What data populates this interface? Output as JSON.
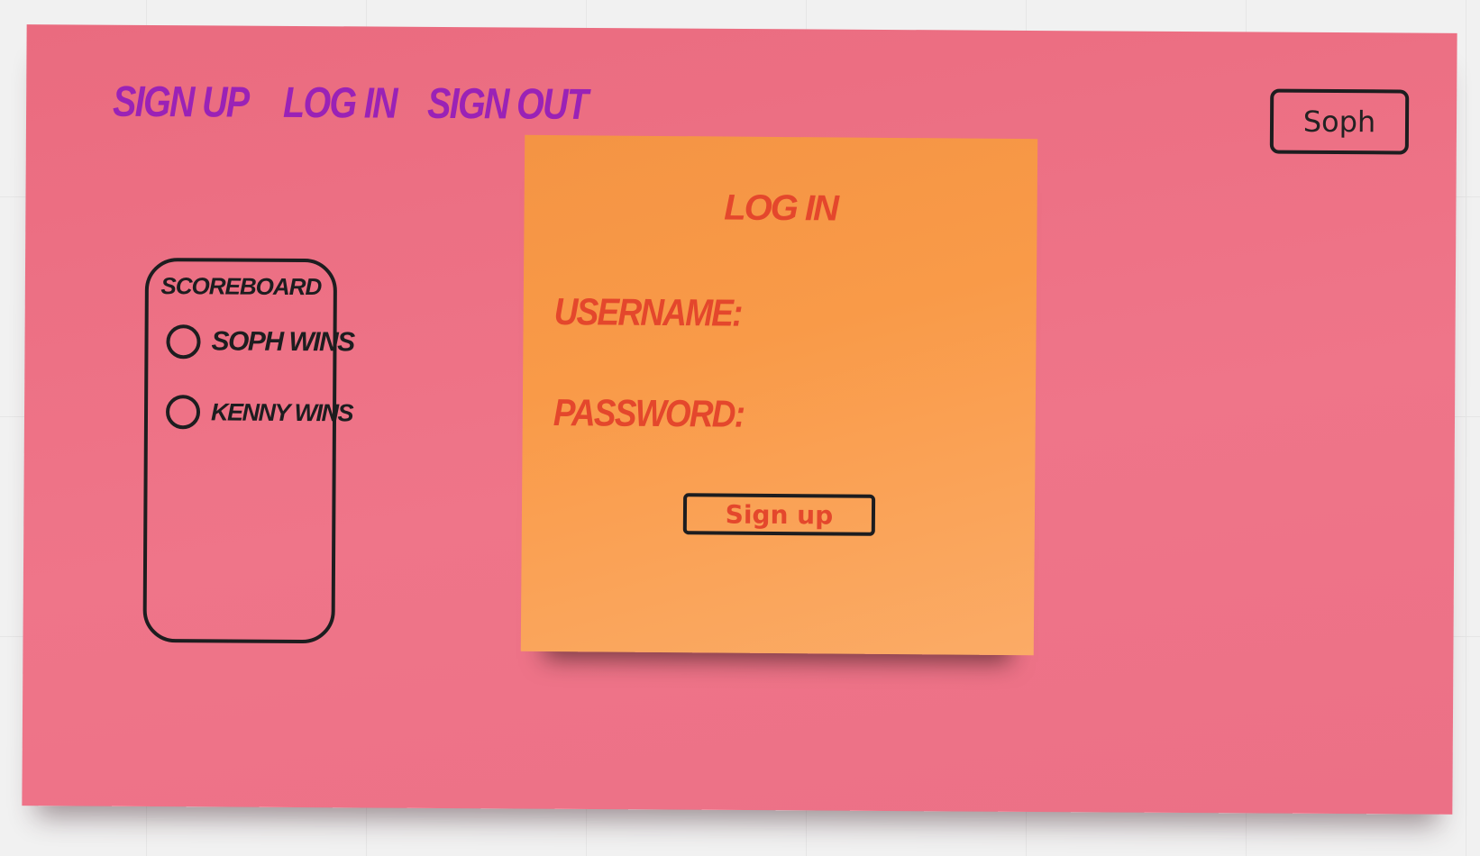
{
  "nav": {
    "links": [
      {
        "label": "Sign up"
      },
      {
        "label": "Log in"
      },
      {
        "label": "Sign out"
      }
    ]
  },
  "user": {
    "name": "Soph"
  },
  "scoreboard": {
    "title": "Scoreboard",
    "rows": [
      {
        "label": "Soph wins"
      },
      {
        "label": "Kenny wins"
      }
    ]
  },
  "login": {
    "title": "Log in",
    "username_label": "Username:",
    "password_label": "Password:",
    "username_value": "",
    "password_value": "",
    "submit_label": "Sign up"
  },
  "colors": {
    "board": "#ec7086",
    "sticky": "#f99a48",
    "nav_link": "#9a22b6",
    "form_text": "#e4472c",
    "outline": "#1d1d1f"
  }
}
